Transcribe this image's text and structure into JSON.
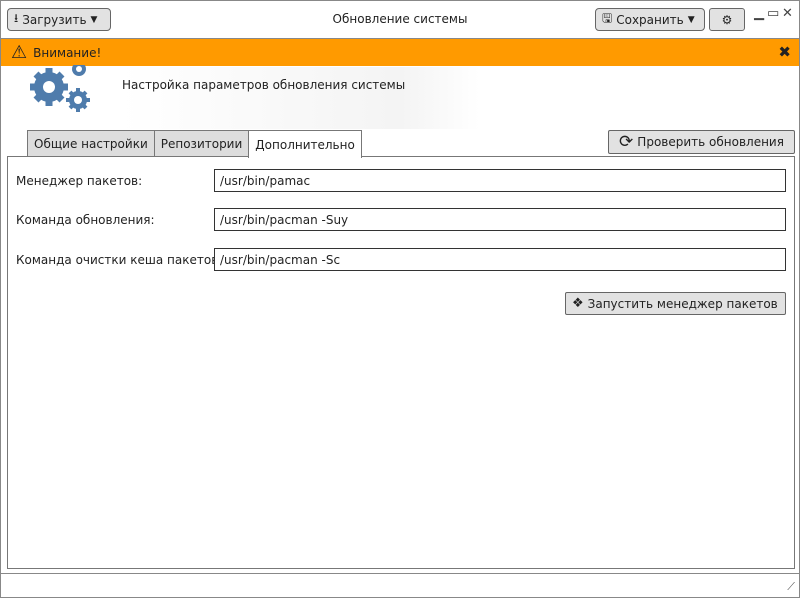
{
  "toolbar": {
    "load_label": "Загрузить",
    "title": "Обновление системы",
    "save_label": "Сохранить"
  },
  "alert": {
    "text": "Внимание!"
  },
  "header": {
    "subtitle": "Настройка параметров обновления системы"
  },
  "tabs": [
    {
      "label": "Общие настройки"
    },
    {
      "label": "Репозитории"
    },
    {
      "label": "Дополнительно"
    }
  ],
  "check_updates_label": "Проверить обновления",
  "fields": [
    {
      "label": "Менеджер пакетов:",
      "value": "/usr/bin/pamac"
    },
    {
      "label": "Команда обновления:",
      "value": "/usr/bin/pacman -Suy"
    },
    {
      "label": "Команда очистки кеша пакетов:",
      "value": "/usr/bin/pacman -Sc"
    }
  ],
  "launch_label": "Запустить менеджер пакетов",
  "colors": {
    "alert": "#ff9a00",
    "gear": "#4f7cac"
  }
}
